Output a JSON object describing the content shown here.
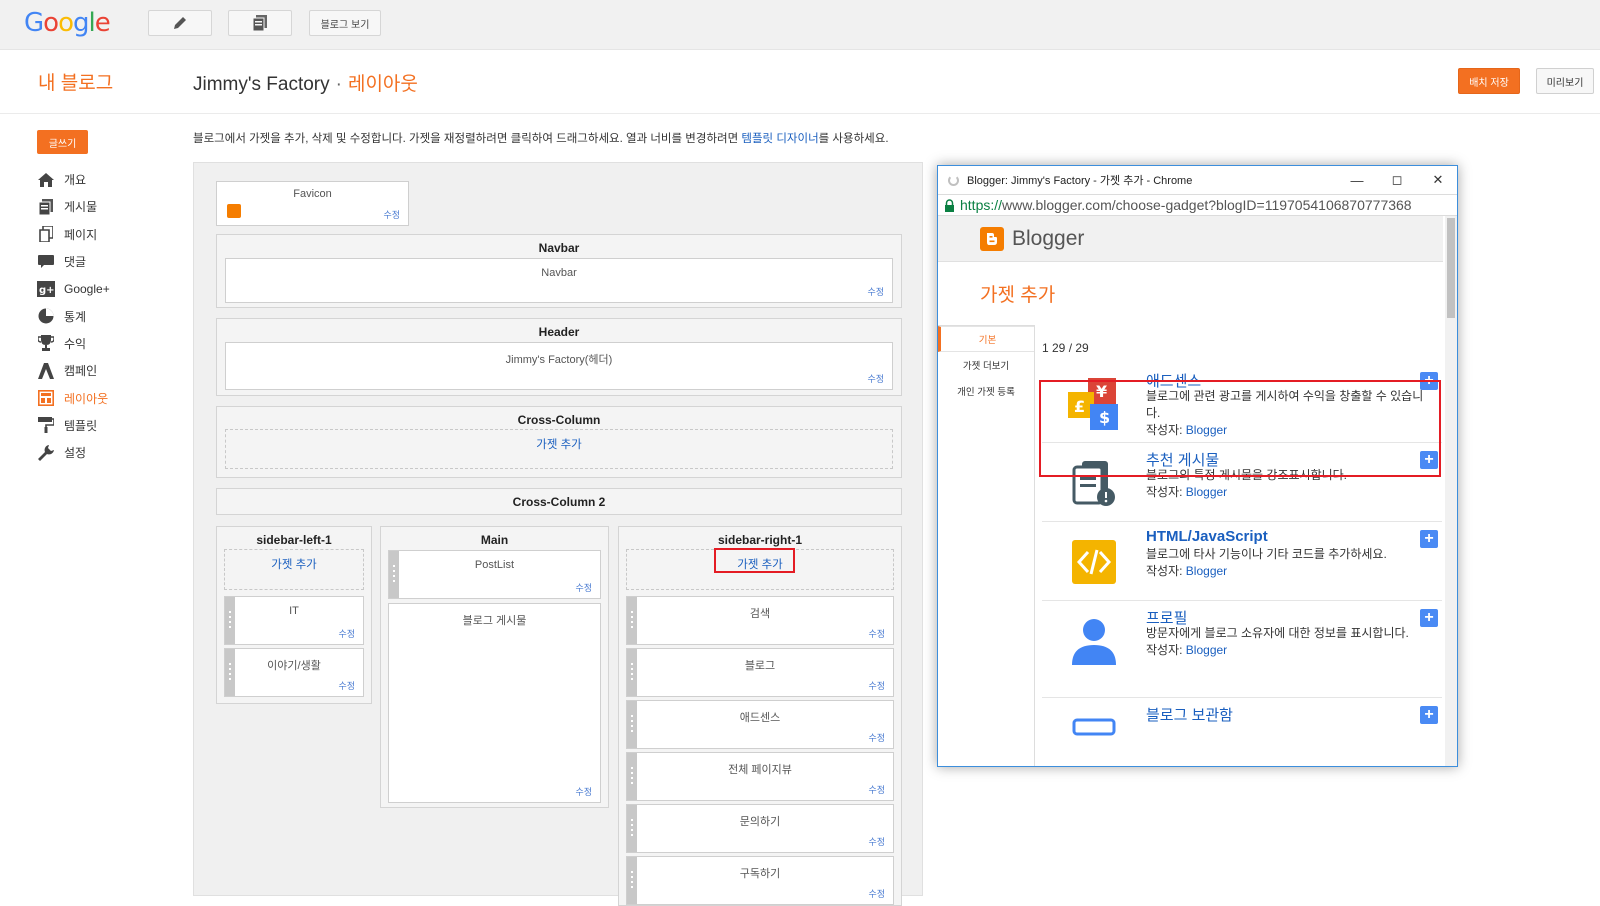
{
  "topbar": {
    "logo": [
      "G",
      "o",
      "o",
      "g",
      "l",
      "e"
    ],
    "view_blog": "블로그 보기",
    "icons": [
      "pencil-icon",
      "posts-icon"
    ]
  },
  "header": {
    "my_blog": "내 블로그",
    "blog_name": "Jimmy's Factory",
    "separator": "·",
    "section": "레이아웃",
    "save_arrangement": "배치 저장",
    "preview": "미리보기"
  },
  "sidebar": {
    "write": "글쓰기",
    "items": [
      {
        "label": "개요",
        "icon": "home-icon"
      },
      {
        "label": "게시물",
        "icon": "posts-icon"
      },
      {
        "label": "페이지",
        "icon": "pages-icon"
      },
      {
        "label": "댓글",
        "icon": "comment-icon"
      },
      {
        "label": "Google+",
        "icon": "google-plus-icon"
      },
      {
        "label": "통계",
        "icon": "pie-chart-icon"
      },
      {
        "label": "수익",
        "icon": "trophy-icon"
      },
      {
        "label": "캠페인",
        "icon": "campaign-icon"
      },
      {
        "label": "레이아웃",
        "icon": "layout-icon",
        "active": true
      },
      {
        "label": "템플릿",
        "icon": "paint-roller-icon"
      },
      {
        "label": "설정",
        "icon": "wrench-icon"
      }
    ]
  },
  "intro": {
    "text": "블로그에서 가젯을 추가, 삭제 및 수정합니다. 가젯을 재정렬하려면 클릭하여 드래그하세요. 열과 너비를 변경하려면 ",
    "link": "템플릿 디자이너",
    "suffix": "를 사용하세요."
  },
  "layout": {
    "edit": "수정",
    "add_gadget": "가젯 추가",
    "favicon": "Favicon",
    "navbar_title": "Navbar",
    "navbar_gadget": "Navbar",
    "header_title": "Header",
    "header_gadget": "Jimmy's Factory(헤더)",
    "cross_column": "Cross-Column",
    "cross_column_2": "Cross-Column 2",
    "sidebar_left": "sidebar-left-1",
    "main": "Main",
    "sidebar_right": "sidebar-right-1",
    "left_gadgets": [
      "IT",
      "이야기/생활"
    ],
    "main_gadgets": [
      "PostList",
      "블로그 게시물"
    ],
    "right_gadgets": [
      "검색",
      "블로그",
      "애드센스",
      "전체 페이지뷰",
      "문의하기",
      "구독하기"
    ]
  },
  "popup": {
    "window_title": "Blogger: Jimmy's Factory - 가젯 추가 - Chrome",
    "url_scheme": "https://",
    "url_rest": "www.blogger.com/choose-gadget?blogID=1197054106870777368",
    "brand": "Blogger",
    "heading": "가젯 추가",
    "tabs": [
      "기본",
      "가젯 더보기",
      "개인 가젯 등록"
    ],
    "count": "1 29 / 29",
    "author_label": "작성자: ",
    "gadgets": [
      {
        "title": "애드센스",
        "desc": "블로그에 관련 광고를 게시하여 수익을 창출할 수 있습니다.",
        "author": "Blogger",
        "icon": "adsense-icon"
      },
      {
        "title": "추천 게시물",
        "desc": "블로그의 특정 게시물을 강조표시합니다.",
        "author": "Blogger",
        "icon": "featured-post-icon"
      },
      {
        "title": "HTML/JavaScript",
        "desc": "블로그에 타사 기능이나 기타 코드를 추가하세요.",
        "author": "Blogger",
        "icon": "code-icon"
      },
      {
        "title": "프로필",
        "desc": "방문자에게 블로그 소유자에 대한 정보를 표시합니다.",
        "author": "Blogger",
        "icon": "profile-icon"
      },
      {
        "title": "블로그 보관함",
        "desc": "",
        "author": "",
        "icon": "archive-icon"
      }
    ]
  },
  "colors": {
    "accent": "#f37021",
    "link": "#1a5fbf",
    "highlight": "#e41c24"
  }
}
